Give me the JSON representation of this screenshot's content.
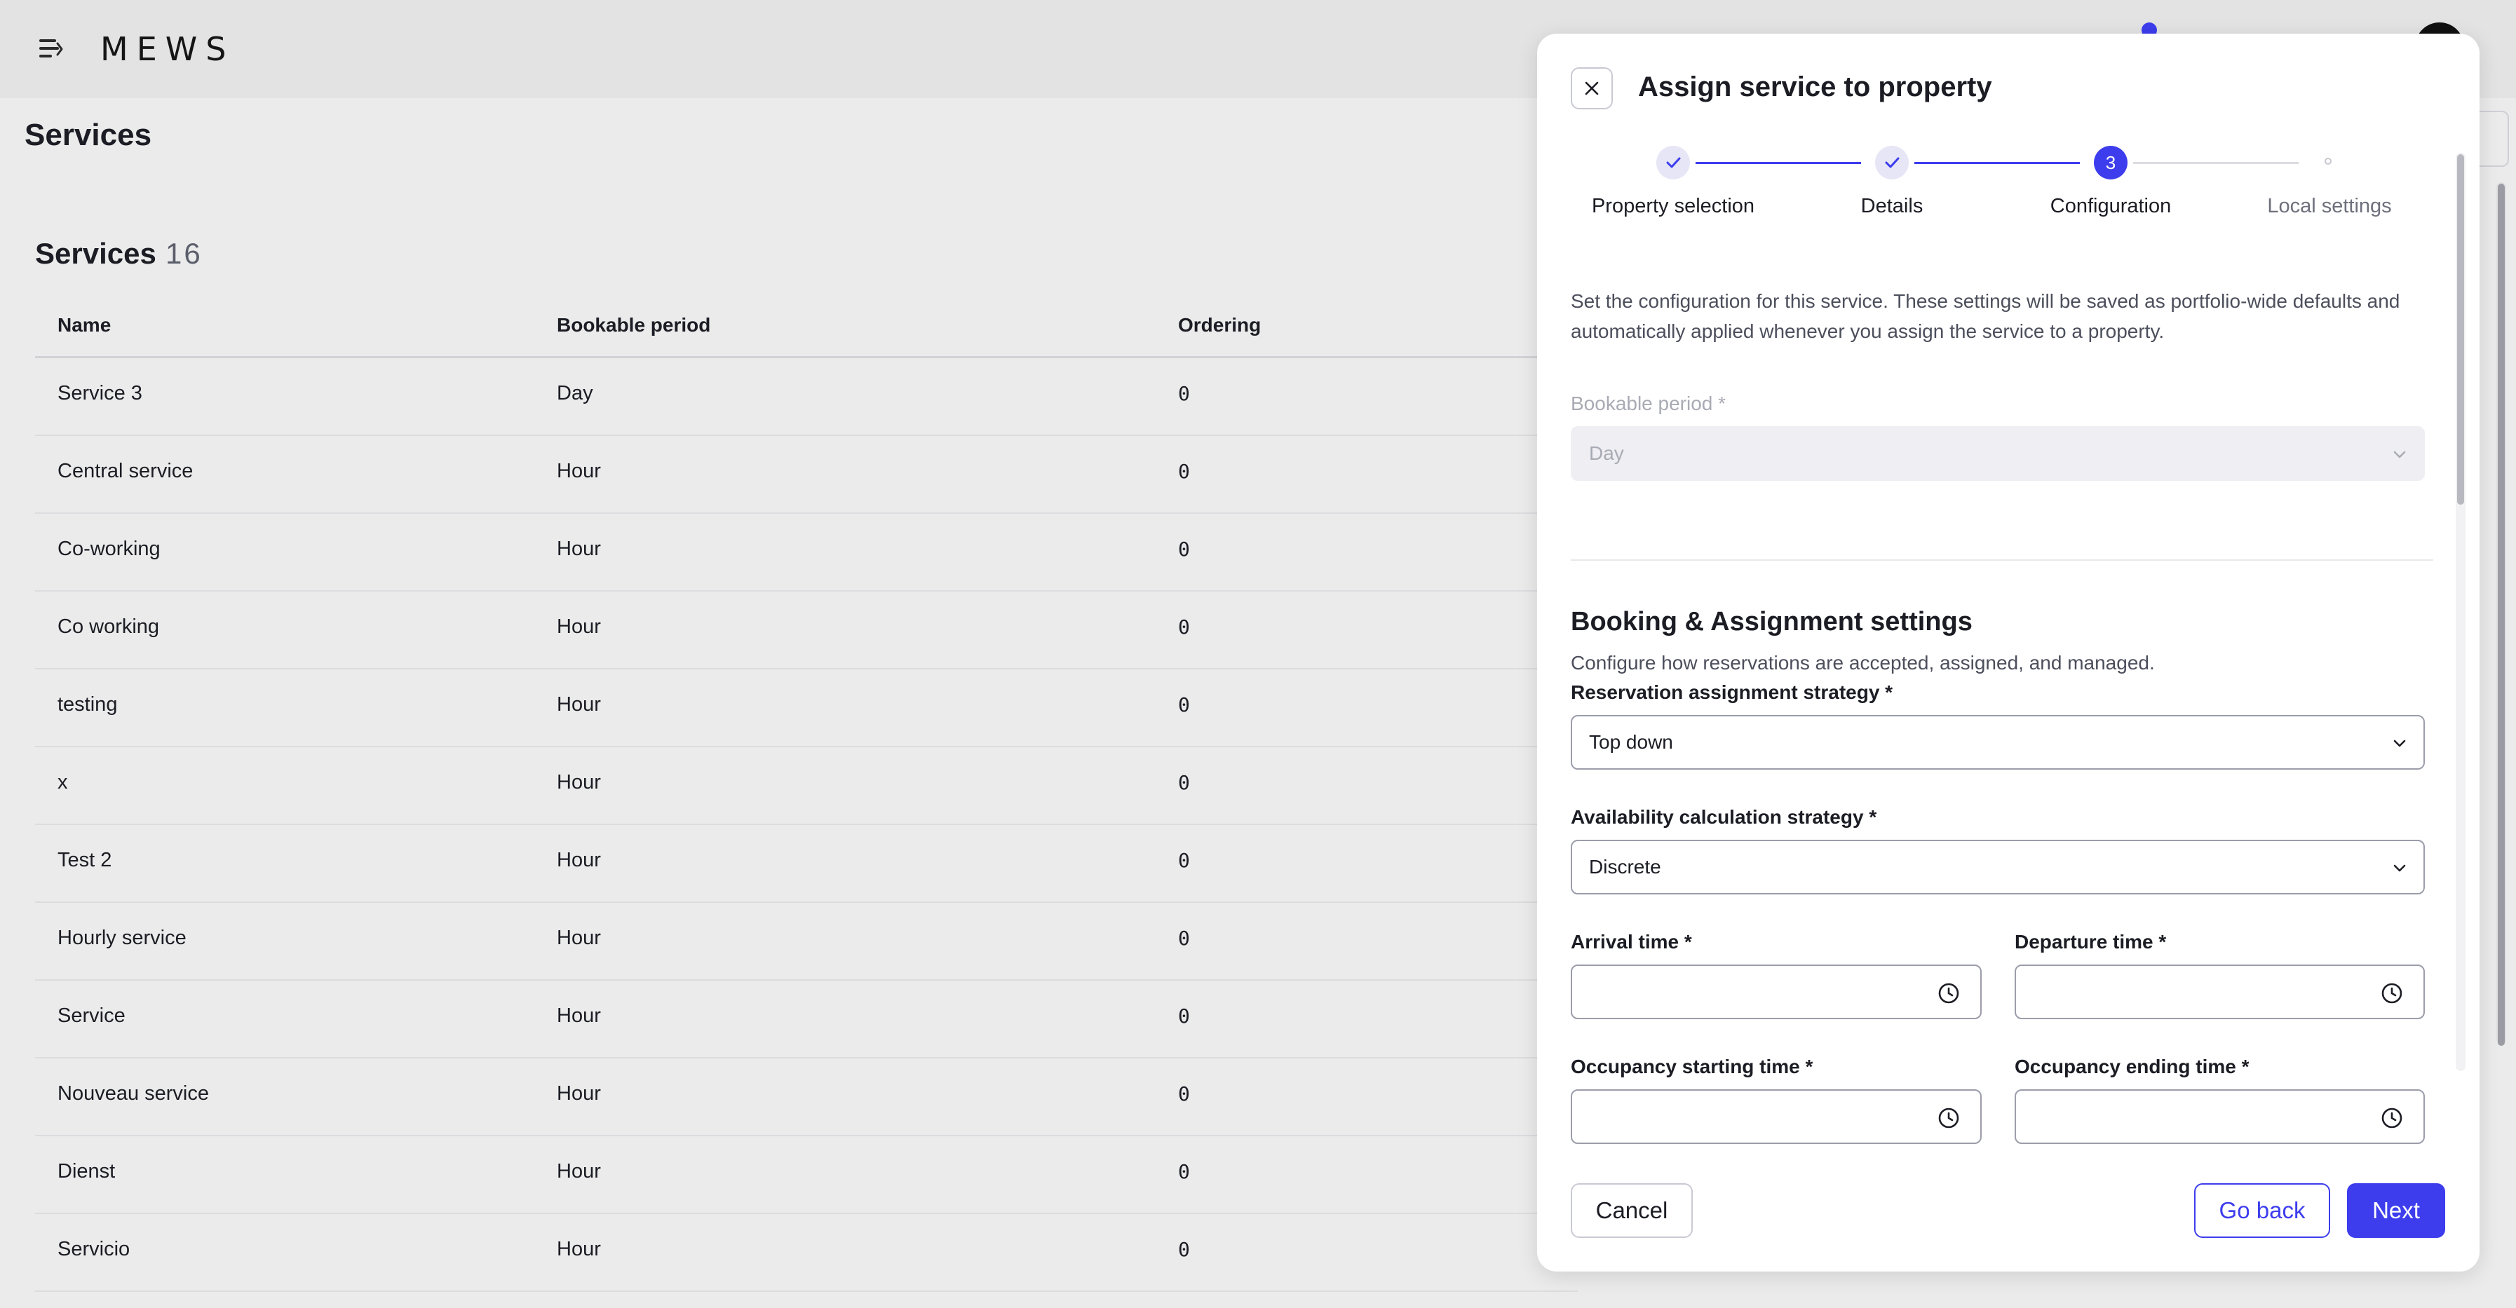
{
  "brand": {
    "logo": "MEWS",
    "accent": "#3d3ded"
  },
  "page": {
    "title": "Services"
  },
  "services": {
    "title": "Services",
    "count": "16",
    "columns": [
      "Name",
      "Bookable period",
      "Ordering"
    ],
    "rows": [
      {
        "name": "Service 3",
        "period": "Day",
        "ordering": "0"
      },
      {
        "name": "Central service",
        "period": "Hour",
        "ordering": "0"
      },
      {
        "name": "Co-working",
        "period": "Hour",
        "ordering": "0"
      },
      {
        "name": "Co working",
        "period": "Hour",
        "ordering": "0"
      },
      {
        "name": "testing",
        "period": "Hour",
        "ordering": "0"
      },
      {
        "name": "x",
        "period": "Hour",
        "ordering": "0"
      },
      {
        "name": "Test 2",
        "period": "Hour",
        "ordering": "0"
      },
      {
        "name": "Hourly service",
        "period": "Hour",
        "ordering": "0"
      },
      {
        "name": "Service",
        "period": "Hour",
        "ordering": "0"
      },
      {
        "name": "Nouveau service",
        "period": "Hour",
        "ordering": "0"
      },
      {
        "name": "Dienst",
        "period": "Hour",
        "ordering": "0"
      },
      {
        "name": "Servicio",
        "period": "Hour",
        "ordering": "0"
      }
    ]
  },
  "modal": {
    "title": "Assign service to property",
    "steps": [
      {
        "label": "Property selection",
        "state": "done"
      },
      {
        "label": "Details",
        "state": "done"
      },
      {
        "label": "Configuration",
        "state": "active",
        "number": "3"
      },
      {
        "label": "Local settings",
        "state": "pending"
      }
    ],
    "intro": "Set the configuration for this service. These settings will be saved as portfolio-wide defaults and automatically applied whenever you assign the service to a property.",
    "bookable_period": {
      "label": "Bookable period *",
      "value": "Day"
    },
    "booking_section": {
      "title": "Booking & Assignment settings",
      "subtitle": "Configure how reservations are accepted, assigned, and managed."
    },
    "reservation_strategy": {
      "label": "Reservation assignment strategy *",
      "value": "Top down"
    },
    "availability_strategy": {
      "label": "Availability calculation strategy *",
      "value": "Discrete"
    },
    "arrival_time": {
      "label": "Arrival time *",
      "value": ""
    },
    "departure_time": {
      "label": "Departure time *",
      "value": ""
    },
    "occupancy_start": {
      "label": "Occupancy starting time *",
      "value": ""
    },
    "occupancy_end": {
      "label": "Occupancy ending time *",
      "value": ""
    },
    "buttons": {
      "cancel": "Cancel",
      "back": "Go back",
      "next": "Next"
    }
  }
}
